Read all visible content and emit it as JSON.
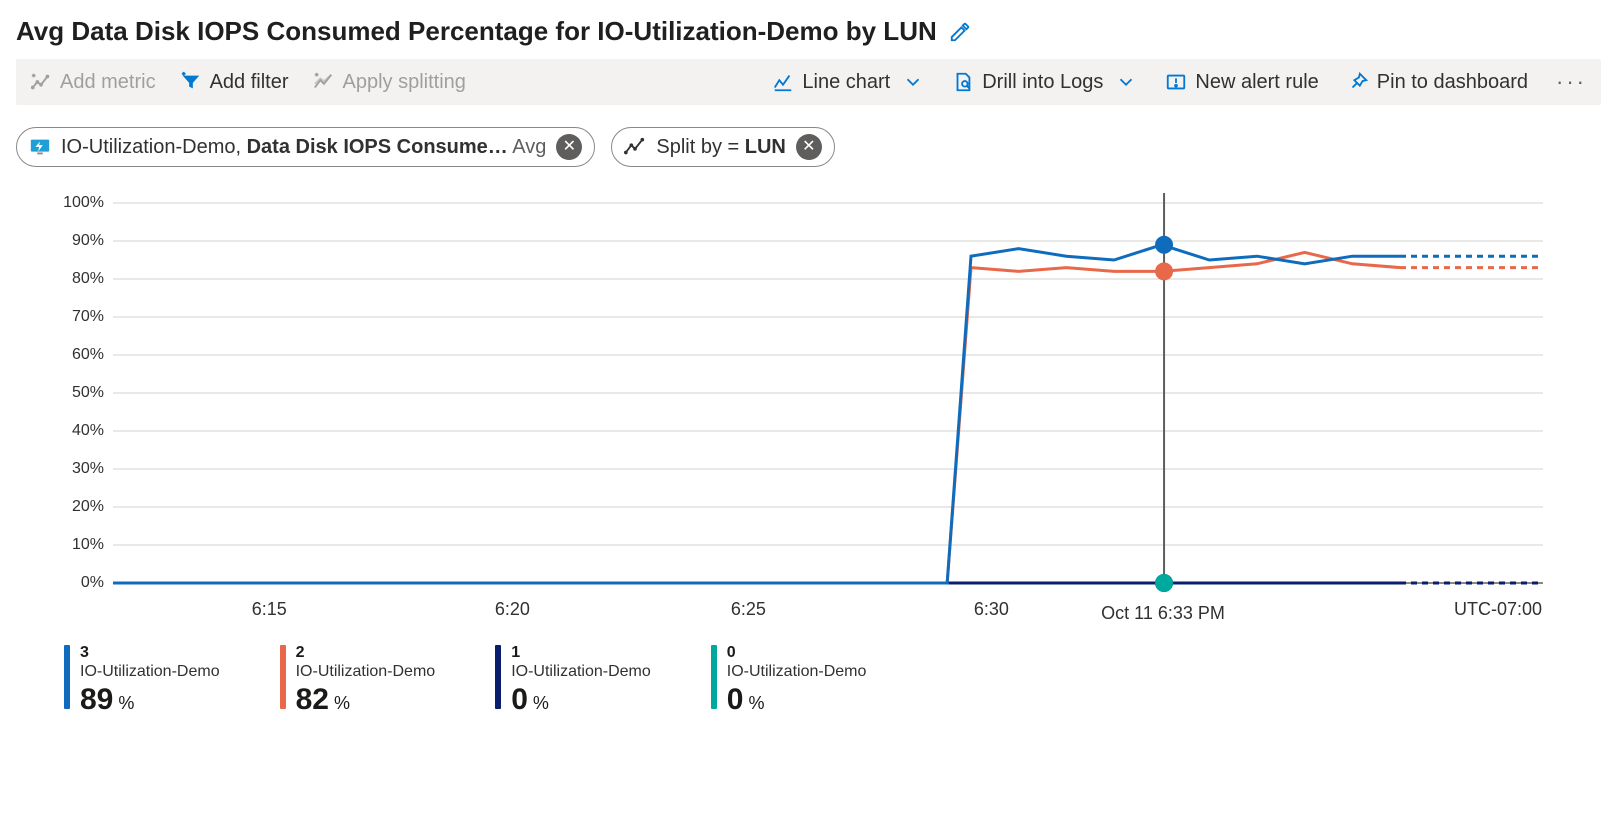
{
  "title": "Avg Data Disk IOPS Consumed Percentage for IO-Utilization-Demo by LUN",
  "toolbar": {
    "add_metric": "Add metric",
    "add_filter": "Add filter",
    "apply_splitting": "Apply splitting",
    "chart_type": "Line chart",
    "drill_logs": "Drill into Logs",
    "new_alert": "New alert rule",
    "pin": "Pin to dashboard"
  },
  "pills": {
    "metric": {
      "resource": "IO-Utilization-Demo",
      "metric": "Data Disk IOPS Consume…",
      "aggregation": "Avg"
    },
    "split": {
      "label": "Split by",
      "value": "LUN"
    }
  },
  "timezone": "UTC-07:00",
  "cursor_label": "Oct 11 6:33 PM",
  "legend": [
    {
      "lun": "3",
      "resource": "IO-Utilization-Demo",
      "value": "89",
      "unit": "%",
      "color": "#0f6cbd"
    },
    {
      "lun": "2",
      "resource": "IO-Utilization-Demo",
      "value": "82",
      "unit": "%",
      "color": "#e8684a"
    },
    {
      "lun": "1",
      "resource": "IO-Utilization-Demo",
      "value": "0",
      "unit": "%",
      "color": "#0a1e6e"
    },
    {
      "lun": "0",
      "resource": "IO-Utilization-Demo",
      "value": "0",
      "unit": "%",
      "color": "#00a99d"
    }
  ],
  "chart_data": {
    "type": "line",
    "title": "Avg Data Disk IOPS Consumed Percentage for IO-Utilization-Demo by LUN",
    "xlabel": "",
    "ylabel": "",
    "ylim": [
      0,
      100
    ],
    "y_ticks": [
      "0%",
      "10%",
      "20%",
      "30%",
      "40%",
      "50%",
      "60%",
      "70%",
      "80%",
      "90%",
      "100%"
    ],
    "x_ticks": [
      "6:15",
      "6:20",
      "6:25",
      "6:30"
    ],
    "x_tick_positions": [
      0.11,
      0.28,
      0.445,
      0.615
    ],
    "cursor_x": 0.735,
    "x_domain_minutes": [
      11,
      41
    ],
    "series": [
      {
        "name": "LUN 3",
        "color": "#0f6cbd",
        "points_min_val": [
          [
            11,
            0
          ],
          [
            28.5,
            0
          ],
          [
            29,
            86
          ],
          [
            30,
            88
          ],
          [
            31,
            86
          ],
          [
            32,
            85
          ],
          [
            33,
            89
          ],
          [
            34,
            85
          ],
          [
            35,
            86
          ],
          [
            36,
            84
          ],
          [
            37,
            86
          ],
          [
            38,
            86
          ]
        ],
        "forecast_min_val": [
          [
            38,
            86
          ],
          [
            41,
            86
          ]
        ],
        "marker_at_cursor": 89
      },
      {
        "name": "LUN 2",
        "color": "#e8684a",
        "points_min_val": [
          [
            11,
            0
          ],
          [
            28.5,
            0
          ],
          [
            29,
            83
          ],
          [
            30,
            82
          ],
          [
            31,
            83
          ],
          [
            32,
            82
          ],
          [
            33,
            82
          ],
          [
            34,
            83
          ],
          [
            35,
            84
          ],
          [
            36,
            87
          ],
          [
            37,
            84
          ],
          [
            38,
            83
          ]
        ],
        "forecast_min_val": [
          [
            38,
            83
          ],
          [
            41,
            83
          ]
        ],
        "marker_at_cursor": 82
      },
      {
        "name": "LUN 1",
        "color": "#0a1e6e",
        "points_min_val": [
          [
            11,
            0
          ],
          [
            38,
            0
          ]
        ],
        "forecast_min_val": [
          [
            38,
            0
          ],
          [
            41,
            0
          ]
        ],
        "marker_at_cursor": 0
      },
      {
        "name": "LUN 0",
        "color": "#00a99d",
        "points_min_val": [
          [
            11,
            0
          ],
          [
            38,
            0
          ]
        ],
        "forecast_min_val": [
          [
            38,
            0
          ],
          [
            41,
            0
          ]
        ],
        "marker_at_cursor": 0
      }
    ]
  }
}
